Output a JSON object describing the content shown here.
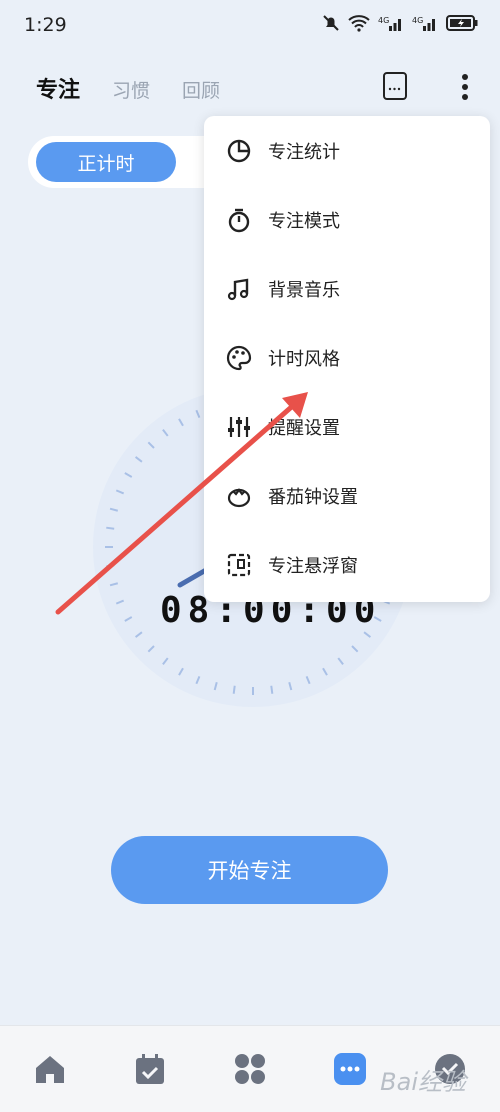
{
  "status_bar": {
    "time": "1:29"
  },
  "header": {
    "tabs": [
      {
        "label": "专注",
        "active": true
      },
      {
        "label": "习惯",
        "active": false
      },
      {
        "label": "回顾",
        "active": false
      }
    ]
  },
  "mode_toggle": {
    "active_label": "正计时"
  },
  "timer": {
    "display": "08:00:00"
  },
  "start_button": {
    "label": "开始专注"
  },
  "menu": {
    "items": [
      {
        "label": "专注统计",
        "icon": "pie-chart-icon"
      },
      {
        "label": "专注模式",
        "icon": "stopwatch-icon"
      },
      {
        "label": "背景音乐",
        "icon": "music-note-icon"
      },
      {
        "label": "计时风格",
        "icon": "palette-icon"
      },
      {
        "label": "提醒设置",
        "icon": "sliders-icon"
      },
      {
        "label": "番茄钟设置",
        "icon": "tomato-icon"
      },
      {
        "label": "专注悬浮窗",
        "icon": "floating-window-icon"
      }
    ]
  },
  "bottom_nav": {
    "items": [
      {
        "icon": "home-icon"
      },
      {
        "icon": "calendar-check-icon"
      },
      {
        "icon": "apps-grid-icon"
      },
      {
        "icon": "focus-icon",
        "active": true
      },
      {
        "icon": "profile-icon"
      }
    ]
  },
  "colors": {
    "accent": "#5a9af0",
    "background": "#eaf0f8",
    "annotation_arrow": "#e8514a"
  },
  "watermark": "Bai经验"
}
